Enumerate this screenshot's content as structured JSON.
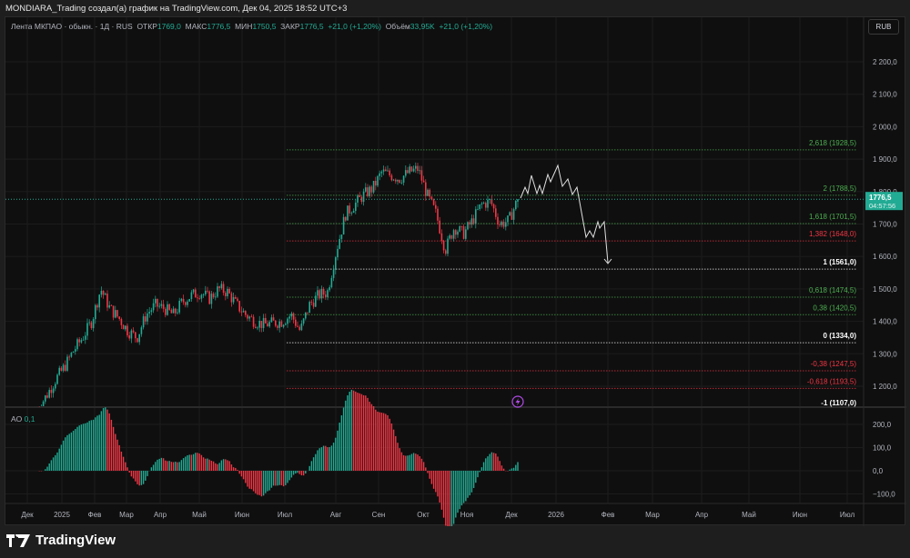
{
  "header": {
    "title": "MONDIARA_Trading создал(а) график на TradingView.com, Дек 04, 2025 18:52 UTC+3"
  },
  "legend": {
    "symbol": "Лента МКПАО · обыкн. · 1Д · RUS",
    "open_label": "ОТКР",
    "open": "1769,0",
    "high_label": "МАКС",
    "high": "1776,5",
    "low_label": "МИН",
    "low": "1750,5",
    "close_label": "ЗАКР",
    "close": "1776,5",
    "change": "+21,0 (+1,20%)",
    "volume_label": "Объём",
    "volume": "33,95K",
    "volume_change": "+21,0 (+1,20%)"
  },
  "currency_button": "RUB",
  "ao": {
    "label": "AO",
    "value": "0,1"
  },
  "footer": {
    "brand": "TradingView"
  },
  "colors": {
    "up": "#22ab94",
    "down": "#f23645",
    "fib_green": "#4caf50",
    "fib_red": "#f23645",
    "fib_white": "#ffffff",
    "last_price": "#22ab94",
    "forecast": "#e0e0e0",
    "lightning": "#b04ae6"
  },
  "chart_data": {
    "type": "candlestick",
    "timeframe": "1Д",
    "x_ticks": [
      "Дек",
      "2025",
      "Фев",
      "Мар",
      "Апр",
      "Май",
      "Июн",
      "Июл",
      "Авг",
      "Сен",
      "Окт",
      "Ноя",
      "Дек",
      "2026",
      "Фев",
      "Мар",
      "Апр",
      "Май",
      "Июн",
      "Июл"
    ],
    "y_ticks": [
      "2 200,0",
      "2 100,0",
      "2 000,0",
      "1 900,0",
      "1 800,0",
      "1 700,0",
      "1 600,0",
      "1 500,0",
      "1 400,0",
      "1 300,0",
      "1 200,0"
    ],
    "y_tick_values": [
      2200,
      2100,
      2000,
      1900,
      1800,
      1700,
      1600,
      1500,
      1400,
      1300,
      1200
    ],
    "ylim": [
      1180,
      2230
    ],
    "approx_weekly_close": [
      1130,
      1170,
      1220,
      1260,
      1310,
      1350,
      1400,
      1500,
      1440,
      1410,
      1370,
      1350,
      1420,
      1450,
      1440,
      1420,
      1460,
      1480,
      1490,
      1470,
      1500,
      1490,
      1450,
      1420,
      1400,
      1390,
      1395,
      1400,
      1420,
      1370,
      1450,
      1480,
      1490,
      1620,
      1730,
      1760,
      1790,
      1810,
      1860,
      1850,
      1840,
      1860,
      1870,
      1790,
      1730,
      1620,
      1690,
      1670,
      1710,
      1760,
      1770,
      1700,
      1710,
      1776.5
    ],
    "last_price": {
      "value": "1776,5",
      "countdown": "04:57:56"
    },
    "fib_levels": [
      {
        "label": "2,618 (1928,5)",
        "price": 1928.5,
        "color": "green"
      },
      {
        "label": "2 (1788,5)",
        "price": 1788.5,
        "color": "green"
      },
      {
        "label": "1,618 (1701,5)",
        "price": 1701.5,
        "color": "green"
      },
      {
        "label": "1,382 (1648,0)",
        "price": 1648.0,
        "color": "red"
      },
      {
        "label": "1 (1561,0)",
        "price": 1561.0,
        "color": "white"
      },
      {
        "label": "0,618 (1474,5)",
        "price": 1474.5,
        "color": "green"
      },
      {
        "label": "0,38 (1420,5)",
        "price": 1420.5,
        "color": "green"
      },
      {
        "label": "0 (1334,0)",
        "price": 1334.0,
        "color": "white"
      },
      {
        "label": "-0,38 (1247,5)",
        "price": 1247.5,
        "color": "red"
      },
      {
        "label": "-0,618 (1193,5)",
        "price": 1193.5,
        "color": "red"
      },
      {
        "label": "-1 (1107,0)",
        "price": 1107.0,
        "color": "white"
      }
    ],
    "ao_ticks": [
      "200,0",
      "100,0",
      "0,0",
      "−100,0"
    ],
    "ao_tick_values": [
      200,
      100,
      0,
      -100
    ]
  }
}
